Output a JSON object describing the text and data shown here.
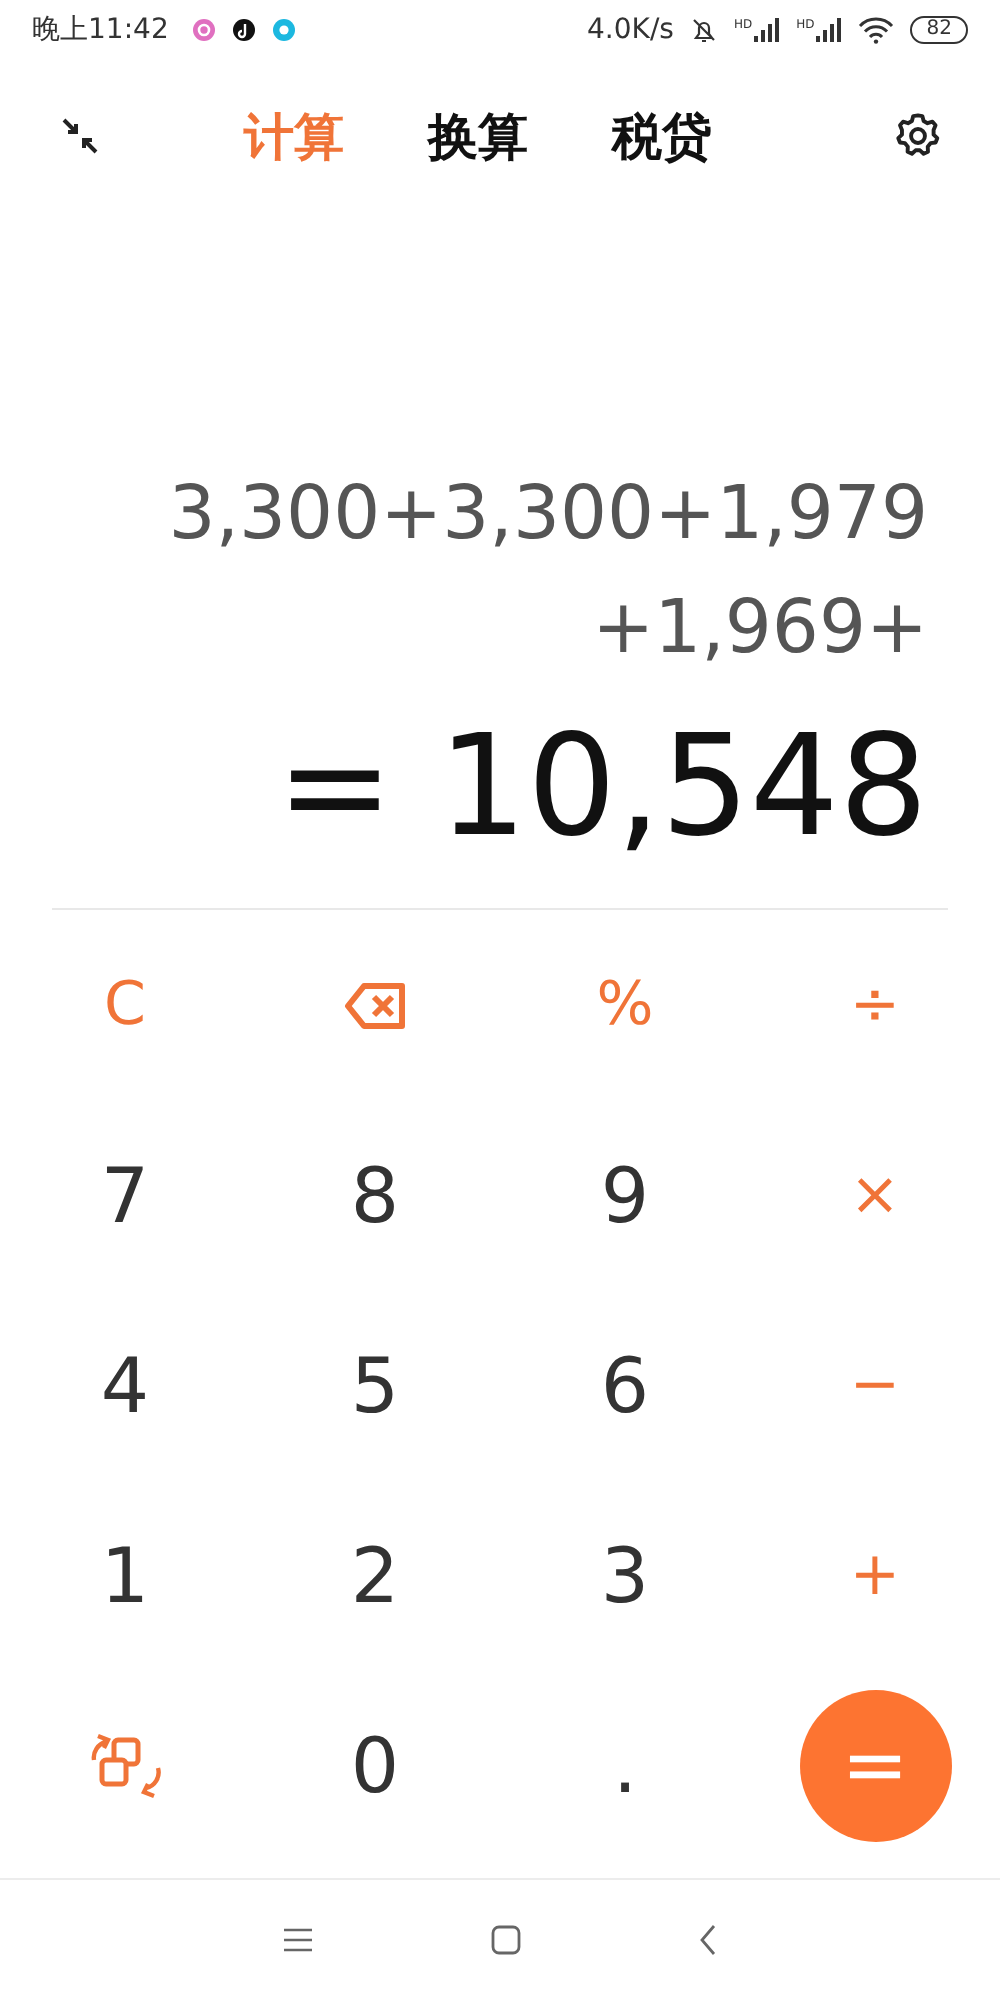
{
  "status_bar": {
    "time": "晚上11:42",
    "net_speed": "4.0K/s",
    "signals": [
      {
        "label": "HD"
      },
      {
        "label": "HD"
      }
    ],
    "battery": "82"
  },
  "tabs": [
    {
      "label": "计算",
      "selected": true
    },
    {
      "label": "换算",
      "selected": false
    },
    {
      "label": "税贷",
      "selected": false
    }
  ],
  "display": {
    "expression": [
      "3,300+3,300+1,979",
      "+1,969+"
    ],
    "result": "= 10,548"
  },
  "keys": [
    {
      "kind": "func",
      "label": "C"
    },
    {
      "kind": "backspace"
    },
    {
      "kind": "func",
      "label": "%"
    },
    {
      "kind": "func",
      "label": "÷"
    },
    {
      "kind": "digit",
      "label": "7"
    },
    {
      "kind": "digit",
      "label": "8"
    },
    {
      "kind": "digit",
      "label": "9"
    },
    {
      "kind": "func",
      "label": "×"
    },
    {
      "kind": "digit",
      "label": "4"
    },
    {
      "kind": "digit",
      "label": "5"
    },
    {
      "kind": "digit",
      "label": "6"
    },
    {
      "kind": "func",
      "label": "−"
    },
    {
      "kind": "digit",
      "label": "1"
    },
    {
      "kind": "digit",
      "label": "2"
    },
    {
      "kind": "digit",
      "label": "3"
    },
    {
      "kind": "func",
      "label": "+"
    },
    {
      "kind": "swap"
    },
    {
      "kind": "digit",
      "label": "0"
    },
    {
      "kind": "digit",
      "label": "."
    },
    {
      "kind": "equals",
      "label": "="
    }
  ]
}
